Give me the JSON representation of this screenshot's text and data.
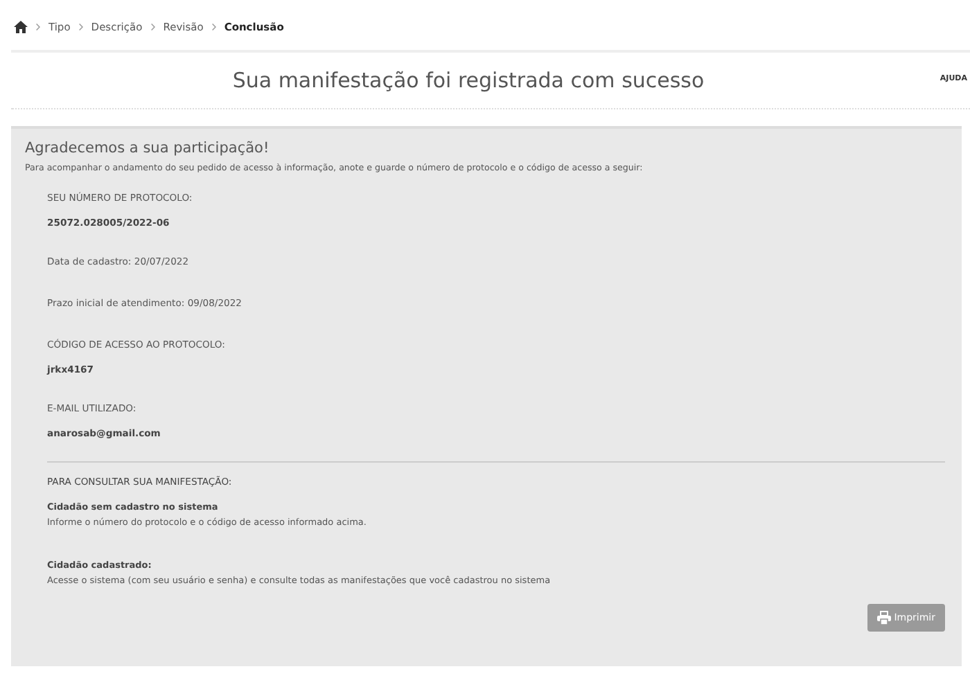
{
  "breadcrumb": [
    {
      "label": "Tipo",
      "current": false
    },
    {
      "label": "Descrição",
      "current": false
    },
    {
      "label": "Revisão",
      "current": false
    },
    {
      "label": "Conclusão",
      "current": true
    }
  ],
  "header": {
    "title": "Sua manifestação foi registrada com sucesso",
    "help": "AJUDA"
  },
  "panel": {
    "heading": "Agradecemos a sua participação!",
    "intro": "Para acompanhar o andamento do seu pedido de acesso à informação, anote e guarde o número de protocolo e o código de acesso a seguir:",
    "fields": [
      {
        "kind": "pair",
        "label": "SEU NÚMERO DE PROTOCOLO:",
        "value": "25072.028005/2022-06"
      },
      {
        "kind": "line",
        "text": "Data de cadastro: 20/07/2022"
      },
      {
        "kind": "line",
        "text": "Prazo inicial de atendimento: 09/08/2022"
      },
      {
        "kind": "pair",
        "label": "CÓDIGO DE ACESSO AO PROTOCOLO:",
        "value": "jrkx4167"
      },
      {
        "kind": "pair",
        "label": "E-MAIL UTILIZADO:",
        "value": "anarosab@gmail.com"
      }
    ],
    "consult": {
      "title": "PARA CONSULTAR SUA MANIFESTAÇÃO:",
      "items": [
        {
          "title": "Cidadão sem cadastro no sistema",
          "text": "Informe o número do protocolo e o código de acesso informado acima."
        },
        {
          "title": "Cidadão cadastrado:",
          "text": "Acesse o sistema (com seu usuário e senha) e consulte todas as manifestações que você cadastrou no sistema"
        }
      ]
    },
    "print_button": "Imprimir"
  }
}
